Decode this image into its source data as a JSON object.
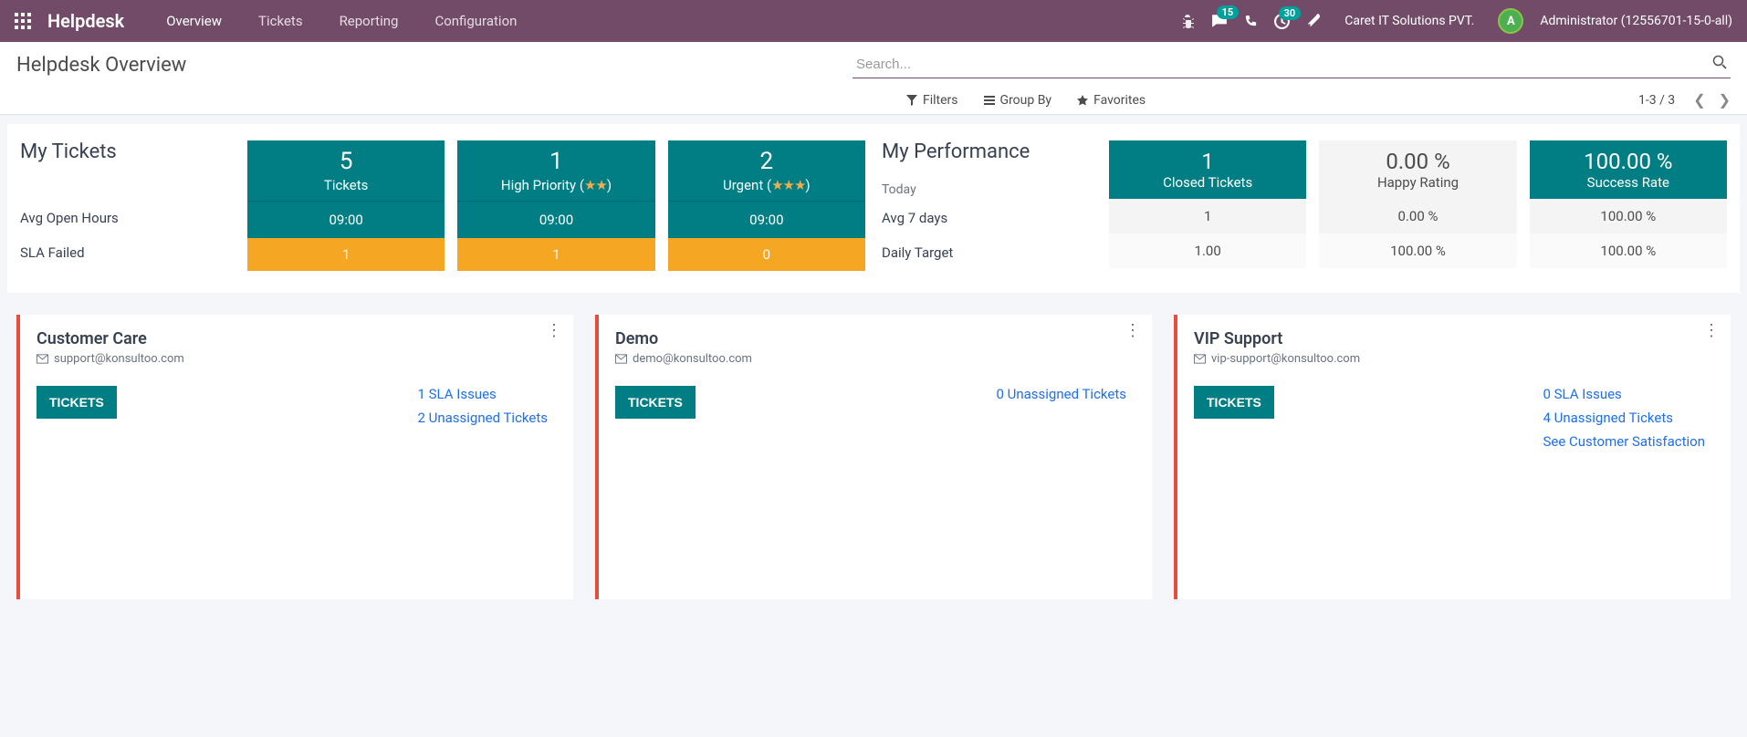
{
  "header": {
    "brand": "Helpdesk",
    "nav": [
      "Overview",
      "Tickets",
      "Reporting",
      "Configuration"
    ],
    "msg_badge": "15",
    "activity_badge": "30",
    "company": "Caret IT Solutions PVT.",
    "avatar_letter": "A",
    "user": "Administrator (12556701-15-0-all)"
  },
  "control": {
    "title": "Helpdesk Overview",
    "search_placeholder": "Search...",
    "filters": "Filters",
    "groupby": "Group By",
    "favorites": "Favorites",
    "pager": "1-3 / 3"
  },
  "my_tickets": {
    "title": "My Tickets",
    "avg_open_label": "Avg Open Hours",
    "sla_failed_label": "SLA Failed",
    "cols": [
      {
        "big": "5",
        "label": "Tickets",
        "stars": "",
        "mid": "09:00",
        "foot": "1"
      },
      {
        "big": "1",
        "label": "High Priority",
        "stars": "★★",
        "mid": "09:00",
        "foot": "1"
      },
      {
        "big": "2",
        "label": "Urgent",
        "stars": "★★★",
        "mid": "09:00",
        "foot": "0"
      }
    ]
  },
  "my_perf": {
    "title": "My Performance",
    "today_label": "Today",
    "avg7_label": "Avg 7 days",
    "target_label": "Daily Target",
    "cols": [
      {
        "big": "1",
        "label": "Closed Tickets",
        "mid": "1",
        "foot": "1.00",
        "highlight": true
      },
      {
        "big": "0.00 %",
        "label": "Happy Rating",
        "mid": "0.00 %",
        "foot": "100.00 %",
        "highlight": false
      },
      {
        "big": "100.00 %",
        "label": "Success Rate",
        "mid": "100.00 %",
        "foot": "100.00 %",
        "highlight": true
      }
    ]
  },
  "teams": [
    {
      "name": "Customer Care",
      "email": "support@konsultoo.com",
      "btn": "TICKETS",
      "links": [
        "1 SLA Issues",
        "2 Unassigned Tickets"
      ]
    },
    {
      "name": "Demo",
      "email": "demo@konsultoo.com",
      "btn": "TICKETS",
      "links": [
        "0 Unassigned Tickets"
      ]
    },
    {
      "name": "VIP Support",
      "email": "vip-support@konsultoo.com",
      "btn": "TICKETS",
      "links": [
        "0 SLA Issues",
        "4 Unassigned Tickets",
        "See Customer Satisfaction"
      ]
    }
  ]
}
